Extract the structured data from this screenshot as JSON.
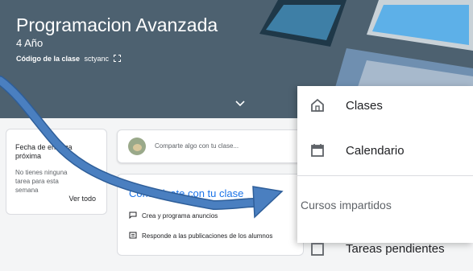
{
  "banner": {
    "title": "Programacion Avanzada",
    "subtitle": "4 Año",
    "code_label": "Código de la clase",
    "code_value": "sctyanc"
  },
  "due": {
    "title": "Fecha de entrega próxima",
    "empty_text": "No tienes ninguna tarea para esta semana",
    "view_all": "Ver todo"
  },
  "share": {
    "placeholder": "Comparte algo con tu clase..."
  },
  "communicate": {
    "title": "Comunicate con tu clase",
    "items": [
      {
        "label": "Crea y programa anuncios",
        "icon": "announcement-icon"
      },
      {
        "label": "Responde a las publicaciones de los alumnos",
        "icon": "reply-icon"
      }
    ]
  },
  "drawer": {
    "items": [
      {
        "label": "Clases",
        "icon": "home-icon"
      },
      {
        "label": "Calendario",
        "icon": "calendar-icon"
      }
    ],
    "section_title": "Cursos impartidos",
    "partial_item": "Tareas pendientes"
  },
  "colors": {
    "banner": "#4d6170",
    "accent": "#1a73e8",
    "arrow": "#4a7fc0"
  }
}
